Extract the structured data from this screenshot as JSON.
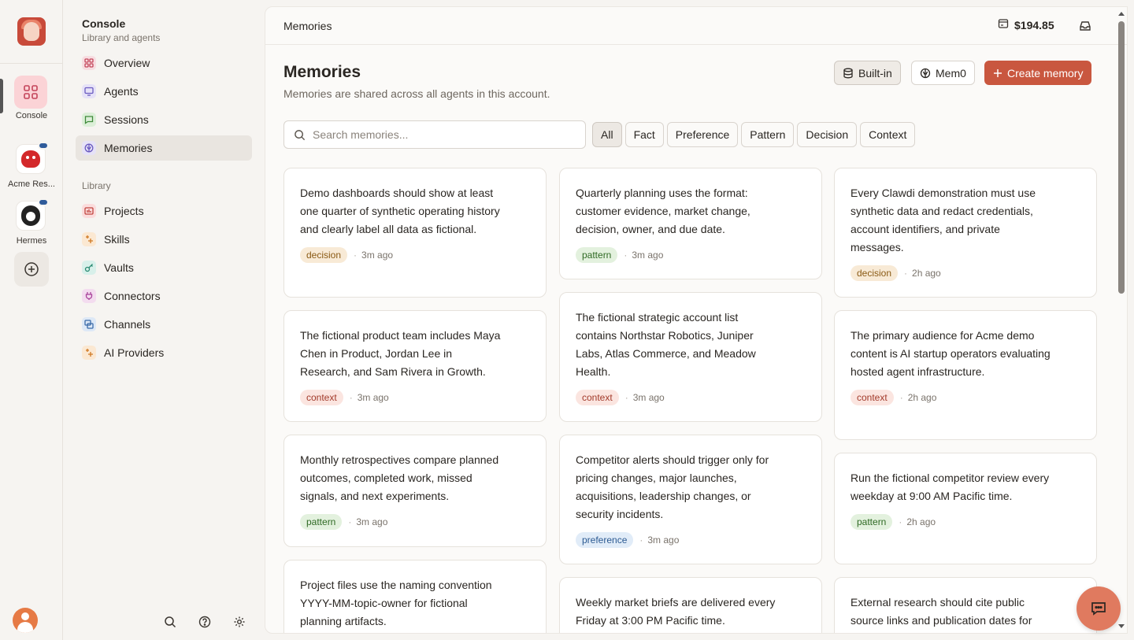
{
  "rail": {
    "console_label": "Console",
    "agents": [
      {
        "label": "Acme Res..."
      },
      {
        "label": "Hermes"
      }
    ]
  },
  "sidebar": {
    "title": "Console",
    "subtitle": "Library and agents",
    "items": [
      {
        "label": "Overview",
        "icon": "grid-icon",
        "color": "#f4d7dc"
      },
      {
        "label": "Agents",
        "icon": "monitor-icon",
        "color": "#e4e0f6"
      },
      {
        "label": "Sessions",
        "icon": "chat-icon",
        "color": "#dcefd8"
      },
      {
        "label": "Memories",
        "icon": "brain-icon",
        "color": "#e4e0f6"
      }
    ],
    "library_label": "Library",
    "library": [
      {
        "label": "Projects",
        "icon": "folder-icon",
        "color": "#fbdcdc"
      },
      {
        "label": "Skills",
        "icon": "sparkle-icon",
        "color": "#fbe8d2"
      },
      {
        "label": "Vaults",
        "icon": "key-icon",
        "color": "#d8f0ea"
      },
      {
        "label": "Connectors",
        "icon": "plug-icon",
        "color": "#f3dcef"
      },
      {
        "label": "Channels",
        "icon": "channels-icon",
        "color": "#dde8f6"
      },
      {
        "label": "AI Providers",
        "icon": "sparkle-icon",
        "color": "#fbe8d2"
      }
    ]
  },
  "topbar": {
    "breadcrumb": "Memories",
    "balance": "$194.85"
  },
  "header": {
    "title": "Memories",
    "description": "Memories are shared across all agents in this account.",
    "builtin_label": "Built-in",
    "mem0_label": "Mem0",
    "create_label": "Create memory"
  },
  "search": {
    "placeholder": "Search memories..."
  },
  "filters": [
    "All",
    "Fact",
    "Preference",
    "Pattern",
    "Decision",
    "Context"
  ],
  "active_filter": "All",
  "columns": [
    [
      {
        "text": "Demo dashboards should show at least one quarter of synthetic operating history and clearly label all data as fictional.",
        "tag": "decision",
        "time": "3m ago"
      },
      {
        "text": "The fictional product team includes Maya Chen in Product, Jordan Lee in Research, and Sam Rivera in Growth.",
        "tag": "context",
        "time": "3m ago"
      },
      {
        "text": "Monthly retrospectives compare planned outcomes, completed work, missed signals, and next experiments.",
        "tag": "pattern",
        "time": "3m ago"
      },
      {
        "text": "Project files use the naming convention YYYY-MM-topic-owner for fictional planning artifacts.",
        "tag": "",
        "time": ""
      }
    ],
    [
      {
        "text": "Quarterly planning uses the format: customer evidence, market change, decision, owner, and due date.",
        "tag": "pattern",
        "time": "3m ago"
      },
      {
        "text": "The fictional strategic account list contains Northstar Robotics, Juniper Labs, Atlas Commerce, and Meadow Health.",
        "tag": "context",
        "time": "3m ago"
      },
      {
        "text": "Competitor alerts should trigger only for pricing changes, major launches, acquisitions, leadership changes, or security incidents.",
        "tag": "preference",
        "time": "3m ago"
      },
      {
        "text": "Weekly market briefs are delivered every Friday at 3:00 PM Pacific time.",
        "tag": "",
        "time": ""
      }
    ],
    [
      {
        "text": "Every Clawdi demonstration must use synthetic data and redact credentials, account identifiers, and private messages.",
        "tag": "decision",
        "time": "2h ago"
      },
      {
        "text": "The primary audience for Acme demo content is AI startup operators evaluating hosted agent infrastructure.",
        "tag": "context",
        "time": "2h ago"
      },
      {
        "text": "Run the fictional competitor review every weekday at 9:00 AM Pacific time.",
        "tag": "pattern",
        "time": "2h ago"
      },
      {
        "text": "External research should cite public source links and publication dates for",
        "tag": "",
        "time": ""
      }
    ]
  ]
}
